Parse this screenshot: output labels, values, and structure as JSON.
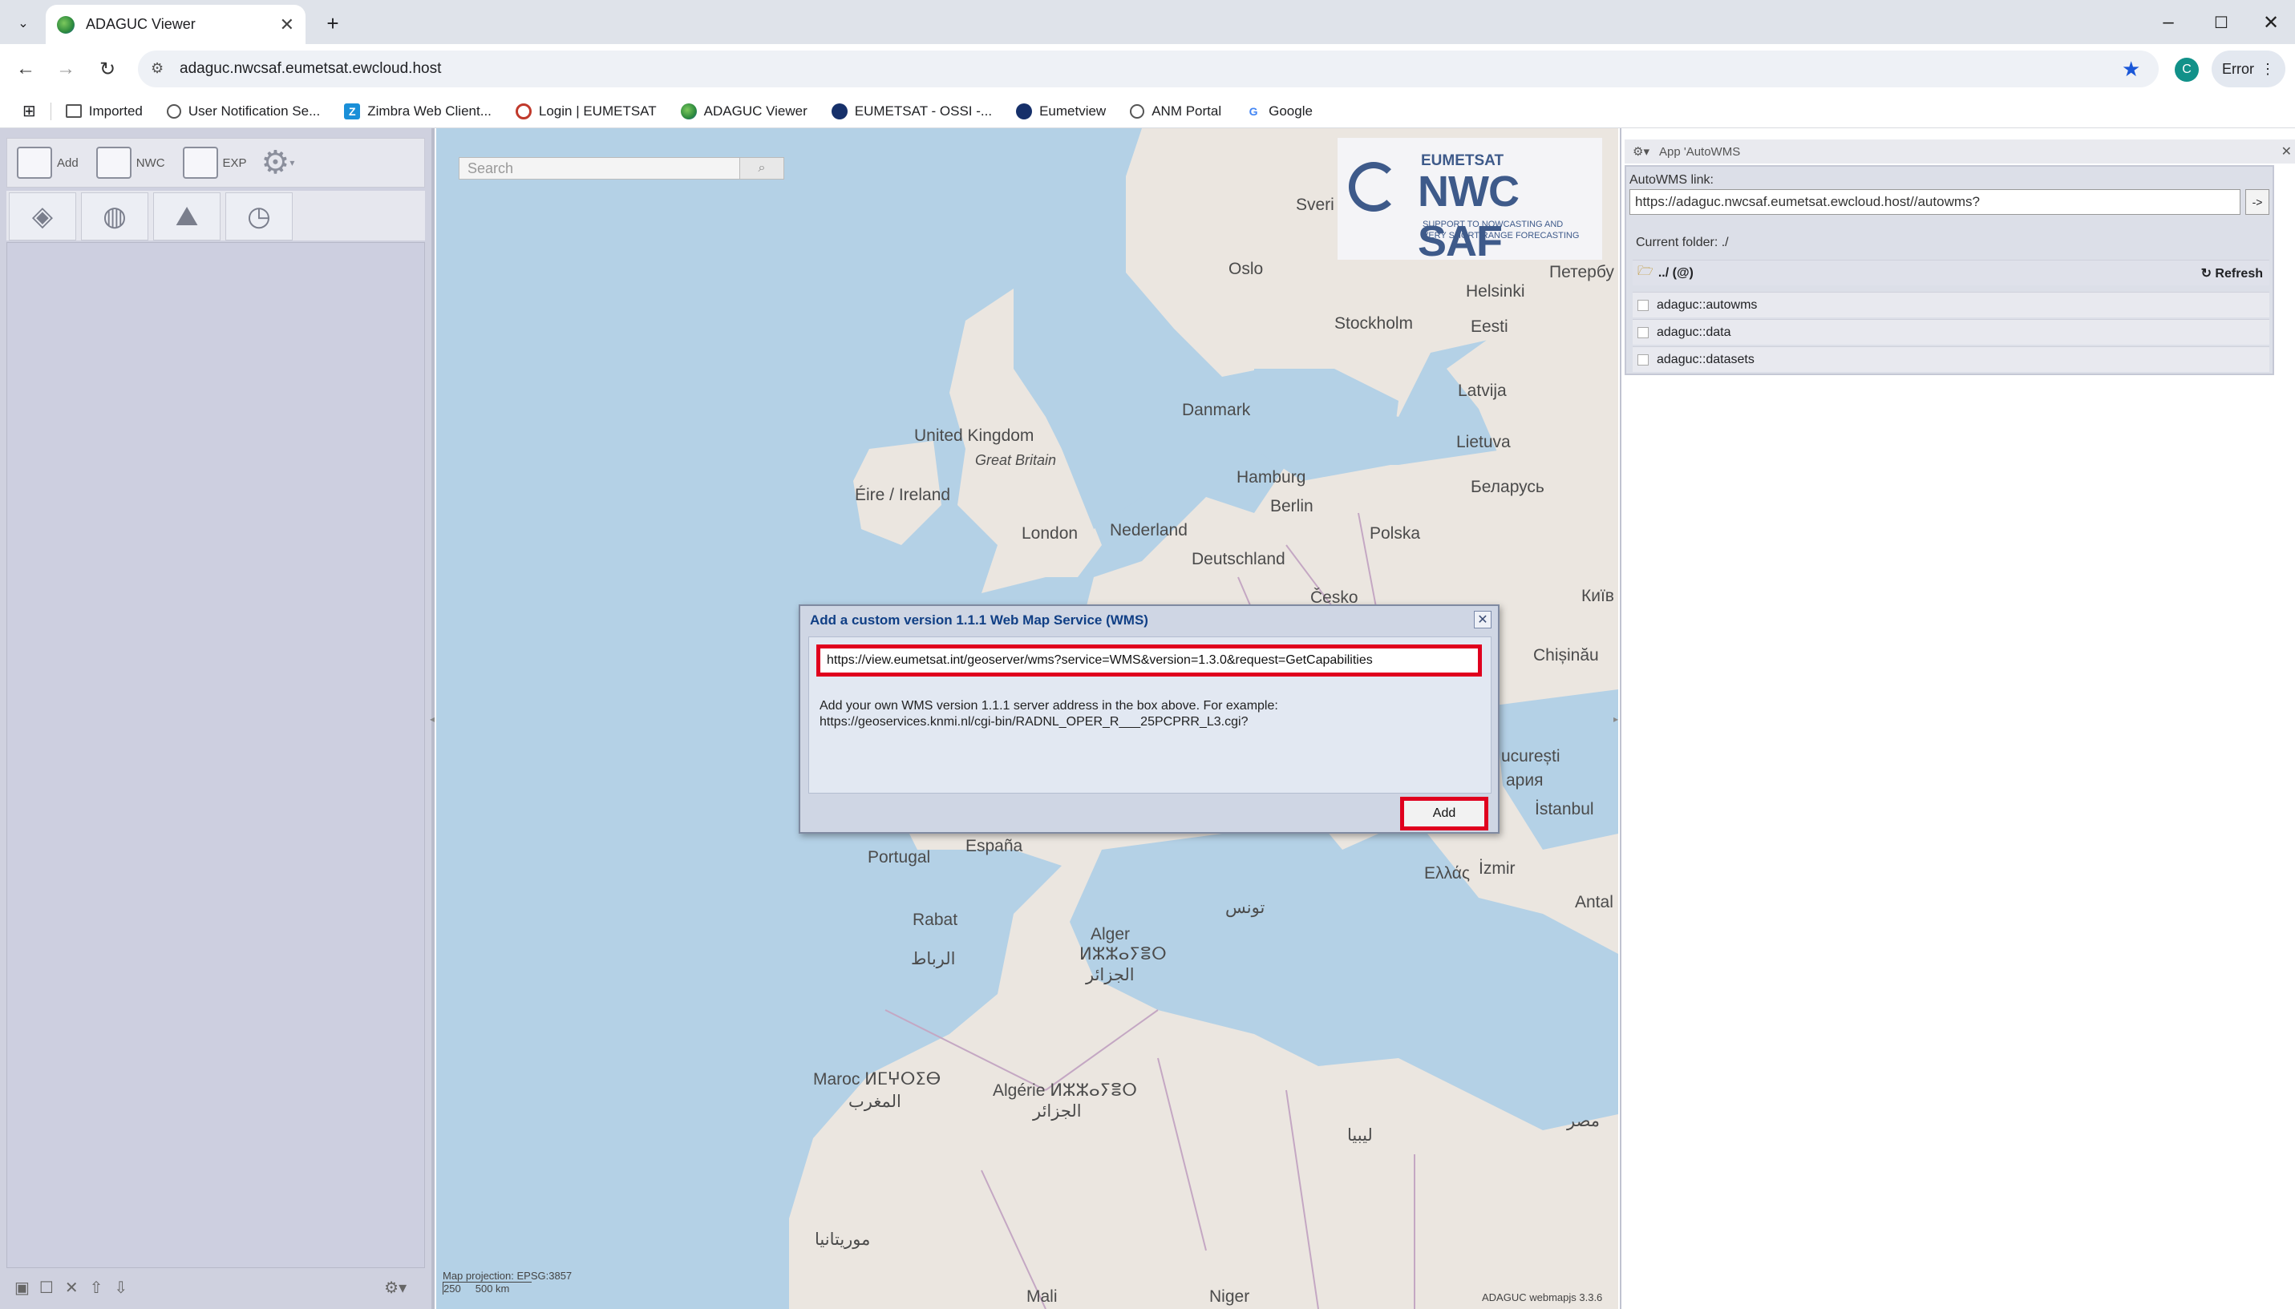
{
  "browser": {
    "tab_title": "ADAGUC Viewer",
    "url": "adaguc.nwcsaf.eumetsat.ewcloud.host",
    "profile_initial": "C",
    "error_label": "Error",
    "bookmarks": [
      {
        "label": "Imported",
        "icon": "folder-icon"
      },
      {
        "label": "User Notification Se...",
        "icon": "globe-icon"
      },
      {
        "label": "Zimbra Web Client...",
        "icon": "zimbra-icon"
      },
      {
        "label": "Login | EUMETSAT",
        "icon": "eumetsat-icon"
      },
      {
        "label": "ADAGUC Viewer",
        "icon": "adaguc-icon"
      },
      {
        "label": "EUMETSAT - OSSI -...",
        "icon": "eumetsat-swirl-icon"
      },
      {
        "label": "Eumetview",
        "icon": "eumetsat-swirl-icon"
      },
      {
        "label": "ANM Portal",
        "icon": "globe-icon"
      },
      {
        "label": "Google",
        "icon": "google-icon"
      }
    ]
  },
  "left_panel": {
    "add_label": "Add",
    "nwc_label": "NWC",
    "exp_label": "EXP"
  },
  "map": {
    "search_placeholder": "Search",
    "logo_top": "EUMETSAT",
    "logo_main": "NWC SAF",
    "logo_sub1": "SUPPORT TO NOWCASTING AND",
    "logo_sub2": "VERY SHORT RANGE FORECASTING",
    "projection": "Map projection: EPSG:3857",
    "scale": "250     500 km",
    "version": "ADAGUC webmapjs 3.3.6",
    "labels": [
      "Sveri",
      "Oslo",
      "Петербу",
      "Helsinki",
      "Stockholm",
      "Eesti",
      "Latvija",
      "Danmark",
      "United Kingdom",
      "Great Britain",
      "Lietuva",
      "Éire / Ireland",
      "Hamburg",
      "Беларусь",
      "Berlin",
      "London",
      "Nederland",
      "Polska",
      "Deutschland",
      "Česko",
      "Київ",
      "Chișinău",
      "ucurești",
      "ария",
      "İstanbul",
      "España",
      "Portugal",
      "Ελλάς",
      "İzmir",
      "Antal",
      "Rabat",
      "Alger",
      "الرباط",
      "ⵍⵣⵣⴰⵢⴻⵔ",
      "الجزائر",
      "تونس",
      "Maroc ⵍⵎⵖⵔⵉⴱ",
      "المغرب",
      "Algérie ⵍⵣⵣⴰⵢⴻⵔ",
      "الجزائر",
      "ليبيا",
      "مصر",
      "موريتانيا",
      "Mali",
      "Niger"
    ]
  },
  "right_panel": {
    "header": "App 'AutoWMS",
    "autowms_label": "AutoWMS link:",
    "autowms_value": "https://adaguc.nwcsaf.eumetsat.ewcloud.host//autowms?",
    "go_label": "->",
    "current_folder": "Current folder: ./",
    "parent_folder": "../ (@)",
    "refresh": "Refresh",
    "items": [
      "adaguc::autowms",
      "adaguc::data",
      "adaguc::datasets"
    ]
  },
  "dialog": {
    "title": "Add a custom version 1.1.1 Web Map Service (WMS)",
    "input_value": "https://view.eumetsat.int/geoserver/wms?service=WMS&version=1.3.0&request=GetCapabilities",
    "help_line1": "Add your own WMS version 1.1.1 server address in the box above. For example:",
    "help_line2": "https://geoservices.knmi.nl/cgi-bin/RADNL_OPER_R___25PCPRR_L3.cgi?",
    "add_label": "Add"
  }
}
